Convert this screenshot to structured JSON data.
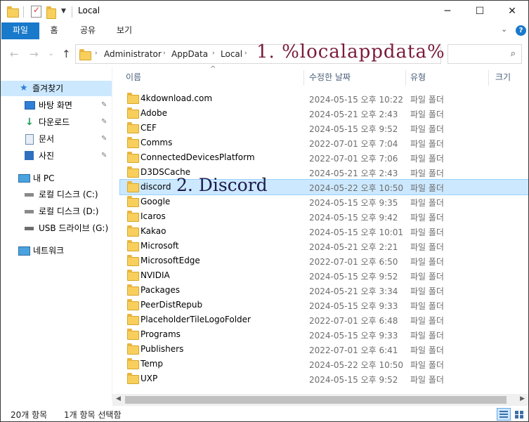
{
  "window": {
    "title": "Local",
    "minimize_glyph": "─",
    "maximize_glyph": "☐",
    "close_glyph": "✕"
  },
  "ribbon": {
    "tabs": [
      {
        "label": "파일",
        "active": true
      },
      {
        "label": "홈",
        "active": false
      },
      {
        "label": "공유",
        "active": false
      },
      {
        "label": "보기",
        "active": false
      }
    ],
    "collapse_glyph": "⌄",
    "help_glyph": "?"
  },
  "address": {
    "back_glyph": "←",
    "forward_glyph": "→",
    "history_glyph": "⌄",
    "up_glyph": "↑",
    "crumbs": [
      "Administrator",
      "AppData",
      "Local"
    ],
    "crumb_sep": "›",
    "annotation": "1. %localappdata%",
    "search_placeholder": ""
  },
  "sidebar": {
    "items": [
      {
        "label": "즐겨찾기",
        "icon": "star-icon",
        "pinned": false,
        "selected": true
      },
      {
        "label": "바탕 화면",
        "icon": "desktop-icon",
        "pinned": true,
        "selected": false
      },
      {
        "label": "다운로드",
        "icon": "download-icon",
        "pinned": true,
        "selected": false
      },
      {
        "label": "문서",
        "icon": "document-icon",
        "pinned": true,
        "selected": false
      },
      {
        "label": "사진",
        "icon": "pictures-icon",
        "pinned": true,
        "selected": false
      },
      {
        "label": "내 PC",
        "icon": "pc-icon",
        "pinned": false,
        "selected": false
      },
      {
        "label": "로컬 디스크 (C:)",
        "icon": "system-drive-icon",
        "pinned": false,
        "selected": false
      },
      {
        "label": "로컬 디스크 (D:)",
        "icon": "drive-icon",
        "pinned": false,
        "selected": false
      },
      {
        "label": "USB 드라이브 (G:)",
        "icon": "usb-drive-icon",
        "pinned": false,
        "selected": false
      },
      {
        "label": "네트워크",
        "icon": "network-icon",
        "pinned": false,
        "selected": false
      }
    ],
    "pin_glyph": "📌"
  },
  "list": {
    "columns": {
      "name": "이름",
      "date": "수정한 날짜",
      "type": "유형",
      "size": "크기"
    },
    "sort_glyph": "^",
    "rows": [
      {
        "name": "4kdownload.com",
        "date": "2024-05-15 오후 10:22",
        "type": "파일 폴더"
      },
      {
        "name": "Adobe",
        "date": "2024-05-21 오후 2:43",
        "type": "파일 폴더"
      },
      {
        "name": "CEF",
        "date": "2024-05-15 오후 9:52",
        "type": "파일 폴더"
      },
      {
        "name": "Comms",
        "date": "2022-07-01 오후 7:04",
        "type": "파일 폴더"
      },
      {
        "name": "ConnectedDevicesPlatform",
        "date": "2022-07-01 오후 7:06",
        "type": "파일 폴더"
      },
      {
        "name": "D3DSCache",
        "date": "2024-05-21 오후 2:43",
        "type": "파일 폴더"
      },
      {
        "name": "discord",
        "date": "2024-05-22 오후 10:50",
        "type": "파일 폴더",
        "selected": true
      },
      {
        "name": "Google",
        "date": "2024-05-15 오후 9:35",
        "type": "파일 폴더"
      },
      {
        "name": "Icaros",
        "date": "2024-05-15 오후 9:42",
        "type": "파일 폴더"
      },
      {
        "name": "Kakao",
        "date": "2024-05-15 오후 10:01",
        "type": "파일 폴더"
      },
      {
        "name": "Microsoft",
        "date": "2024-05-21 오후 2:21",
        "type": "파일 폴더"
      },
      {
        "name": "MicrosoftEdge",
        "date": "2022-07-01 오후 6:50",
        "type": "파일 폴더"
      },
      {
        "name": "NVIDIA",
        "date": "2024-05-15 오후 9:52",
        "type": "파일 폴더"
      },
      {
        "name": "Packages",
        "date": "2024-05-21 오후 3:34",
        "type": "파일 폴더"
      },
      {
        "name": "PeerDistRepub",
        "date": "2024-05-15 오후 9:33",
        "type": "파일 폴더"
      },
      {
        "name": "PlaceholderTileLogoFolder",
        "date": "2022-07-01 오후 6:48",
        "type": "파일 폴더"
      },
      {
        "name": "Programs",
        "date": "2024-05-15 오후 9:33",
        "type": "파일 폴더"
      },
      {
        "name": "Publishers",
        "date": "2022-07-01 오후 6:41",
        "type": "파일 폴더"
      },
      {
        "name": "Temp",
        "date": "2024-05-22 오후 10:50",
        "type": "파일 폴더"
      },
      {
        "name": "UXP",
        "date": "2024-05-15 오후 9:52",
        "type": "파일 폴더"
      }
    ],
    "selected_annotation": "2. Discord"
  },
  "status": {
    "item_count": "20개 항목",
    "selection": "1개 항목 선택함"
  },
  "colors": {
    "accent": "#1979ca",
    "selection": "#cce8ff",
    "folder": "#f8cf5c",
    "annotation1": "#7a1a3a",
    "annotation2": "#1a1a4a"
  }
}
